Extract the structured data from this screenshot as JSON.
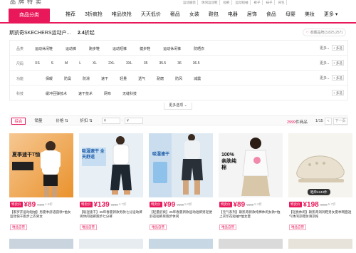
{
  "header": {
    "brand": "品牌特卖",
    "tags": [
      "运动服装",
      "休闲运动鞋",
      "短裤",
      "运动短袖",
      "裤子",
      "袜子",
      "背包"
    ]
  },
  "nav": {
    "category_button": "商品分类",
    "items": [
      "推荐",
      "3折疯抢",
      "唯品快抢",
      "天天低价",
      "奢品",
      "女装",
      "鞋包",
      "电器",
      "居饰",
      "食品",
      "母婴",
      "美妆",
      "更多"
    ]
  },
  "summary": {
    "title": "斯凯奇SKECHERS运动户...",
    "discount_value": "2.4",
    "discount_suffix": "折起",
    "favorite_label": "收藏品牌(3,825,257)"
  },
  "filters": [
    {
      "label": "品类",
      "options": [
        "运动休闲鞋",
        "运动裤",
        "跑步鞋",
        "运动短裤",
        "健步鞋",
        "运动休闲裤",
        "防晒衣"
      ]
    },
    {
      "label": "尺码",
      "options": [
        "XS",
        "S",
        "M",
        "L",
        "XL",
        "2XL",
        "3XL",
        "35",
        "35.5",
        "36",
        "36.5"
      ]
    },
    {
      "label": "功能",
      "options": [
        "保暖",
        "防臭",
        "防滑",
        "速干",
        "轻量",
        "透气",
        "耐磨",
        "防风",
        "减震"
      ]
    },
    {
      "label": "科技",
      "options": [
        "缓冲回弹技术",
        "速干技术",
        "网布",
        "无缝科技"
      ]
    }
  ],
  "filter_more": "更多",
  "filter_multi": "+ 多选",
  "more_options": "更多选项",
  "sortbar": {
    "sorts": [
      "综合",
      "销量",
      "价格",
      "折扣"
    ],
    "price_from": "¥",
    "price_to": "¥",
    "count_value": "2999",
    "count_suffix": "件商品",
    "page": "1/15",
    "prev": "<",
    "next": "下一页"
  },
  "products": [
    {
      "tag": "特卖价",
      "price": "¥89",
      "orig": "¥499",
      "disc": "1.8折",
      "title": "【家罗开运动短袖】男夏季舒适圆领T恤女运动快干跑步上衣男女",
      "badge": "唯品自营",
      "promo": "夏季速干T恤"
    },
    {
      "tag": "特卖价",
      "price": "¥139",
      "orig": "¥299",
      "disc": "4.7折",
      "title": "【吸湿速干】25年春夏新款男款七分运动裤男休闲短裤跑步七分裤",
      "badge": "唯品自营",
      "promo": "吸湿速干 全天舒适"
    },
    {
      "tag": "特卖价",
      "price": "¥99",
      "orig": "¥199",
      "disc": "5.0折",
      "title": "【轻量舒爽】25年春夏新款运动短裤男轻便舒适短裤男跑步休闲",
      "badge": "唯品自营",
      "promo": "吸湿速干"
    },
    {
      "tag": "特卖价",
      "price": "¥89",
      "orig": "¥169",
      "disc": "5.3折",
      "title": "【元气系列】斯凯奇新款纯棉休闲女款T恤上衣印花短袖T恤女夏",
      "badge": "唯品自营",
      "promo": "100% 亲肤纯棉"
    },
    {
      "tag": "特卖价",
      "price": "¥198",
      "orig": "¥349",
      "disc": "5.7折",
      "title": "【轻质休闲】斯凯奇洞洞鞋男女夏季网面透气休闲凉鞋防滑凉拖",
      "badge": "唯品自营",
      "promo": "晒单4243件"
    }
  ]
}
